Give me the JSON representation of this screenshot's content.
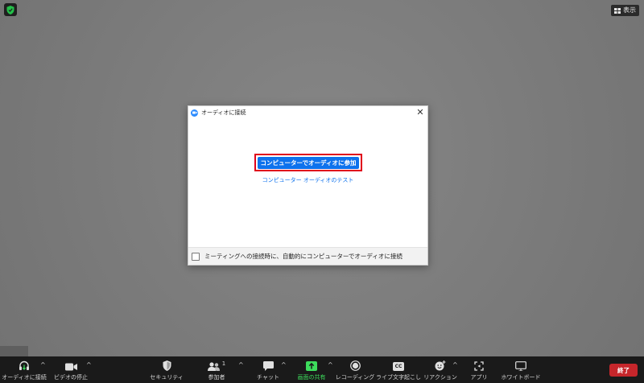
{
  "header": {
    "view_label": "表示"
  },
  "dialog": {
    "title": "オーディオに接続",
    "join_button": "コンピューターでオーディオに参加",
    "test_link": "コンピューター オーディオのテスト",
    "checkbox_label": "ミーティングへの接続時に、自動的にコンピューターでオーディオに接続",
    "checkbox_checked": false
  },
  "toolbar": {
    "audio": "オーディオに接続",
    "video": "ビデオの停止",
    "security": "セキュリティ",
    "participants": "参加者",
    "participants_count": "1",
    "chat": "チャット",
    "share": "画面の共有",
    "record": "レコーディング",
    "captions": "ライブ文字起こし",
    "reactions": "リアクション",
    "apps": "アプリ",
    "whiteboard": "ホワイトボード",
    "end": "終了",
    "cc_badge": "CC"
  },
  "colors": {
    "accent": "#0e72ed",
    "highlight_border": "#e0001b",
    "share_green": "#3ddc5c",
    "end_red": "#c6262b"
  }
}
